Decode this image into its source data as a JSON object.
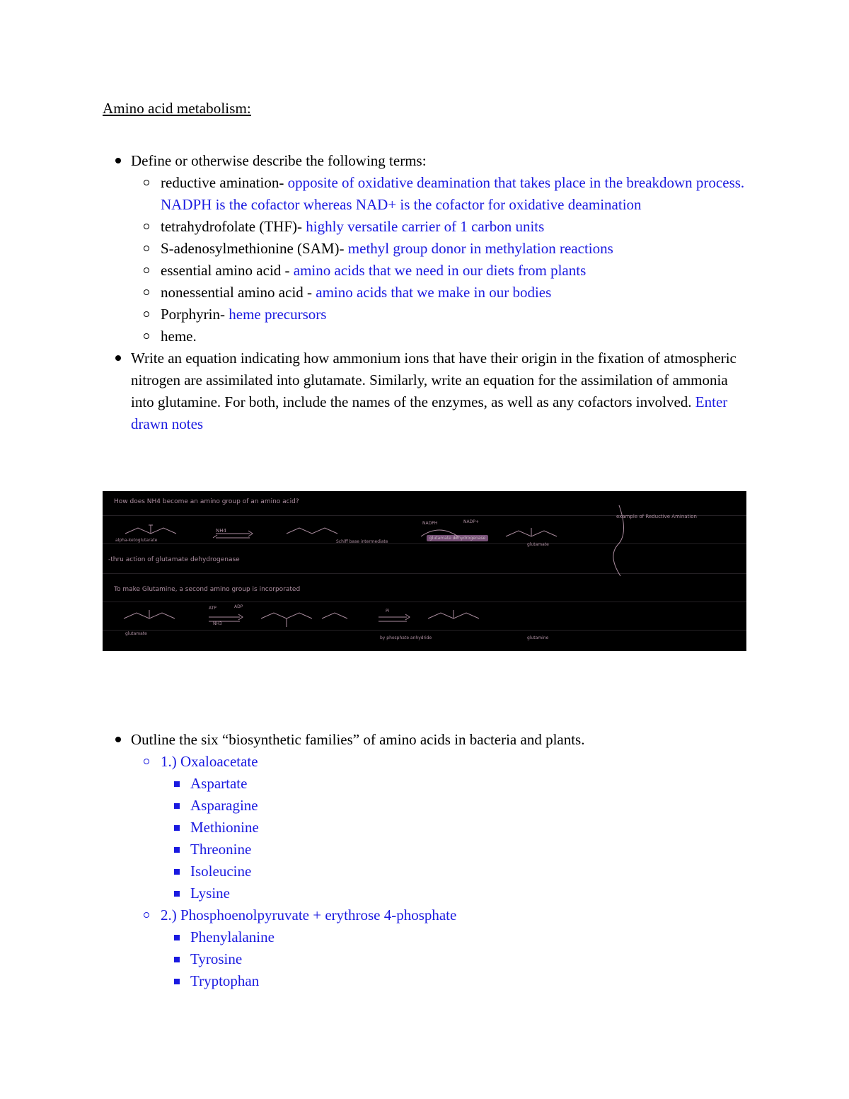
{
  "document": {
    "title": "Amino acid metabolism:",
    "sections": [
      {
        "heading": "Define or otherwise describe the following terms:",
        "terms": [
          {
            "term": "reductive amination-",
            "definition": "opposite of oxidative deamination that takes place in the breakdown process. NADPH is the cofactor whereas NAD+ is the cofactor for oxidative deamination"
          },
          {
            "term": "tetrahydrofolate (THF)-",
            "definition": "highly versatile carrier of 1 carbon units"
          },
          {
            "term": "S-adenosylmethionine (SAM)-",
            "definition": "methyl group donor in methylation reactions"
          },
          {
            "term": "essential amino acid -",
            "definition": "amino acids that we need in our diets from plants"
          },
          {
            "term": "nonessential amino acid -",
            "definition": "amino acids that we make in our bodies"
          },
          {
            "term": "Porphyrin-",
            "definition": "heme precursors"
          },
          {
            "term": "heme.",
            "definition": ""
          }
        ]
      }
    ],
    "equation_prompt": {
      "text": "Write an equation indicating how ammonium ions that have their origin in the fixation of atmospheric nitrogen are assimilated into glutamate. Similarly, write an equation for the assimilation of ammonia into glutamine. For both, include the names of the enzymes, as well as any cofactors involved.",
      "answer": "Enter drawn notes"
    },
    "notes_image": {
      "caption_lines": [
        "How does NH4 become an amino group of an amino acid?",
        "-thru action of glutamate dehydrogenase",
        "To make Glutamine, a second amino group is incorporated"
      ],
      "labels": [
        "alpha-ketoglutarate",
        "NH4",
        "Schiff base intermediate",
        "NADPH",
        "NADP+",
        "glutamate dehydrogenase",
        "glutamate",
        "example of Reductive Amination",
        "ATP",
        "ADP",
        "glutamate",
        "NH3",
        "Pi",
        "glutamine",
        "by phosphate anhydride",
        "glutamine"
      ]
    },
    "families": {
      "heading": "Outline the six “biosynthetic families” of amino acids in bacteria and plants.",
      "groups": [
        {
          "label": "1.) Oxaloacetate",
          "members": [
            "Aspartate",
            "Asparagine",
            "Methionine",
            "Threonine",
            "Isoleucine",
            "Lysine"
          ]
        },
        {
          "label": "2.) Phosphoenolpyruvate + erythrose 4-phosphate",
          "members": [
            "Phenylalanine",
            "Tyrosine",
            "Tryptophan"
          ]
        }
      ]
    },
    "colors": {
      "answer_blue": "#1a1ae0",
      "body_black": "#000000",
      "notes_bg": "#000000",
      "notes_ink": "#c9a6bb",
      "notes_highlight": "#8b5e8b"
    }
  }
}
